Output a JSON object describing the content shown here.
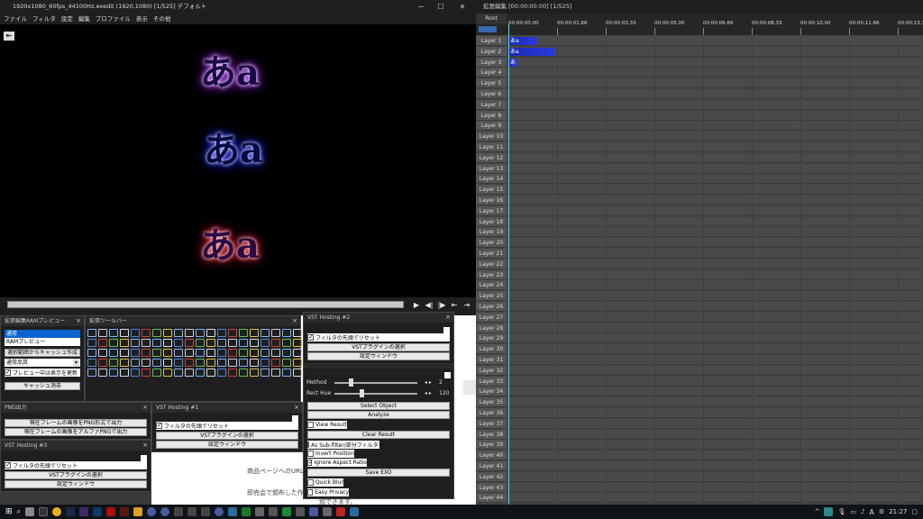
{
  "window": {
    "title": "1920x1080_60fps_44100Hz.exedit (1920,1080) [1/525] デフォルト"
  },
  "menu": [
    "ファイル",
    "フィルタ",
    "設定",
    "編集",
    "プロファイル",
    "表示",
    "その他"
  ],
  "preview_text": [
    "あa",
    "あa",
    "あa"
  ],
  "ram_panel": {
    "title": "拡張編集RAMプレビュー",
    "list": [
      "通常",
      "RAMプレビュー"
    ],
    "cache_button": "選択範囲からキャッシュ作成",
    "quality": "通常品質",
    "checkbox_label": "プレビュー中は表示を更新",
    "clear_button": "キャッシュ消去"
  },
  "toolbar_panel": {
    "title": "拡張ツールバー"
  },
  "png_panel": {
    "title": "PNG出力",
    "btn1": "現在フレームの画像をPNG形式で出力",
    "btn2": "現在フレームの画像をアルファPNGで出力"
  },
  "vst1": {
    "title": "VST Hosting #1",
    "check": "フィルタの先頭でリセット",
    "select": "VSTプラグインの選択",
    "window": "設定ウィンドウ"
  },
  "vst2": {
    "title": "VST Hosting #2",
    "check": "フィルタの先頭でリセット",
    "select": "VSTプラグインの選択",
    "window": "設定ウィンドウ"
  },
  "vst3": {
    "title": "VST Hosting #3",
    "check": "フィルタの先頭でリセット",
    "select": "VSTプラグインの選択",
    "window": "設定ウィンドウ"
  },
  "motion_panel": {
    "method_label": "Method",
    "method_value": "2",
    "recthue_label": "Rect Hue",
    "recthue_value": "120",
    "select_object": "Select Object",
    "analyze": "Analyze",
    "view_result": "View Result",
    "clear_result": "Clear Result",
    "as_subfilter": "As Sub-filter/部分フィルター",
    "invert_position": "Invert Position",
    "ignore_aspect": "Ignore Aspect Ratio",
    "save_exo": "Save EXO",
    "quick_blur": "Quick Blur",
    "easy_privacy": "Easy Privacy"
  },
  "doc_text": [
    "商品ページへのURL",
    "即売会で頒布した作",
    "頒できます。"
  ],
  "timeline": {
    "title": "拡張編集 [00:00:00.00] [1/525]",
    "root": "Root",
    "times": [
      "00:00:00.00",
      "00:00:01.66",
      "00:00:03.33",
      "00:00:05.00",
      "00:00:06.66",
      "00:00:08.33",
      "00:00:10.00",
      "00:00:11.66",
      "00:00:13.3"
    ],
    "layers": [
      "Layer 1",
      "Layer 2",
      "Layer 3",
      "Layer 4",
      "Layer 5",
      "Layer 6",
      "Layer 7",
      "Layer 8",
      "Layer 9",
      "Layer 10",
      "Layer 11",
      "Layer 12",
      "Layer 13",
      "Layer 14",
      "Layer 15",
      "Layer 16",
      "Layer 17",
      "Layer 18",
      "Layer 19",
      "Layer 20",
      "Layer 21",
      "Layer 22",
      "Layer 23",
      "Layer 24",
      "Layer 25",
      "Layer 26",
      "Layer 27",
      "Layer 28",
      "Layer 29",
      "Layer 30",
      "Layer 31",
      "Layer 32",
      "Layer 33",
      "Layer 34",
      "Layer 35",
      "Layer 36",
      "Layer 37",
      "Layer 38",
      "Layer 39",
      "Layer 40",
      "Layer 41",
      "Layer 42",
      "Layer 43",
      "Layer 44"
    ],
    "clips": [
      "あa",
      "あa",
      "あa"
    ]
  },
  "taskbar": {
    "time": "21:27",
    "ime": "A"
  }
}
